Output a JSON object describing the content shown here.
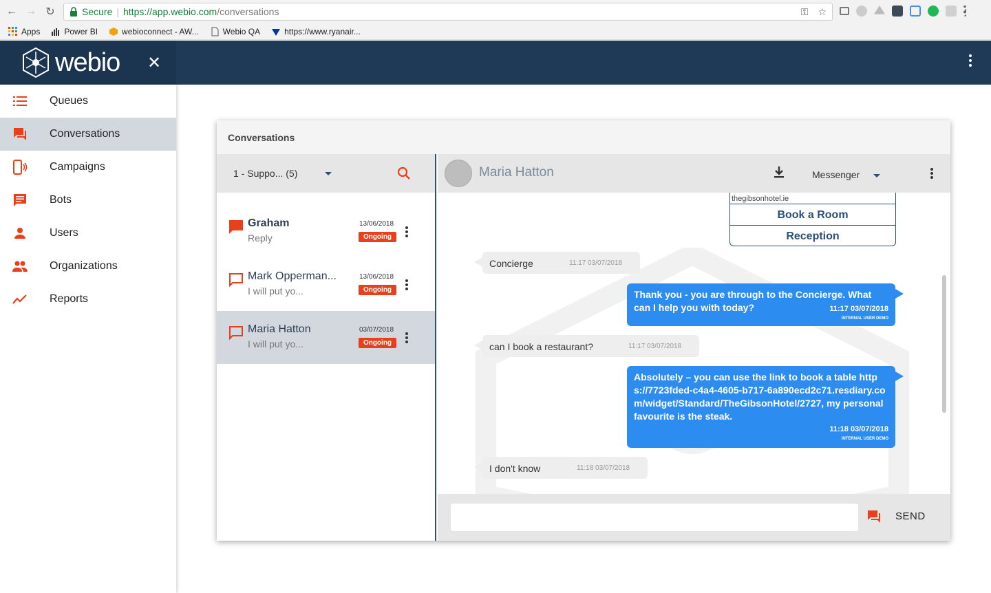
{
  "browser": {
    "secure_label": "Secure",
    "url_host": "https://app.webio.com",
    "url_path": "/conversations",
    "bookmarks": [
      "Apps",
      "Power BI",
      "webioconnect - AW...",
      "Webio QA",
      "https://www.ryanair..."
    ]
  },
  "app": {
    "logo_text": "webio",
    "close_symbol": "✕"
  },
  "sidebar": {
    "items": [
      {
        "label": "Queues",
        "icon": "list-icon"
      },
      {
        "label": "Conversations",
        "icon": "chat-icon"
      },
      {
        "label": "Campaigns",
        "icon": "phone-broadcast-icon"
      },
      {
        "label": "Bots",
        "icon": "bot-icon"
      },
      {
        "label": "Users",
        "icon": "user-icon"
      },
      {
        "label": "Organizations",
        "icon": "group-icon"
      },
      {
        "label": "Reports",
        "icon": "trend-icon"
      }
    ]
  },
  "panel": {
    "title": "Conversations",
    "queue_selector": "1 - Suppo... (5)",
    "conversations": [
      {
        "name": "Graham",
        "preview": "Reply",
        "date": "13/06/2018",
        "status": "Ongoing"
      },
      {
        "name": "Mark Opperman...",
        "preview": "I will put yo...",
        "date": "13/06/2018",
        "status": "Ongoing"
      },
      {
        "name": "Maria Hatton",
        "preview": "I will put yo...",
        "date": "03/07/2018",
        "status": "Ongoing"
      }
    ]
  },
  "chat": {
    "contact_name": "Maria Hatton",
    "channel": "Messenger",
    "card": {
      "domain": "thegibsonhotel.ie",
      "buttons": [
        "Book a Room",
        "Reception"
      ]
    },
    "messages": [
      {
        "dir": "in",
        "text": "Concierge",
        "time": "11:17 03/07/2018"
      },
      {
        "dir": "out",
        "text": "Thank you - you are through to the Concierge. What can I help you with today?",
        "time": "11:17 03/07/2018",
        "sub": "INTERNAL USER DEMO"
      },
      {
        "dir": "in",
        "text": "can I book a restaurant?",
        "time": "11:17 03/07/2018"
      },
      {
        "dir": "out",
        "text": "Absolutely – you can use the link to book a table https://7723fded-c4a4-4605-b717-6a890ecd2c71.resdiary.com/widget/Standard/TheGibsonHotel/2727, my personal favourite is the steak.",
        "time": "11:18 03/07/2018",
        "sub": "INTERNAL USER DEMO"
      },
      {
        "dir": "in",
        "text": "I don't know",
        "time": "11:18 03/07/2018"
      }
    ],
    "composer": {
      "placeholder": "",
      "send_label": "SEND"
    }
  },
  "colors": {
    "header": "#1f3a57",
    "accent": "#e8401c",
    "bubble_out": "#2d8cf0",
    "active_row": "#d3d8de"
  }
}
